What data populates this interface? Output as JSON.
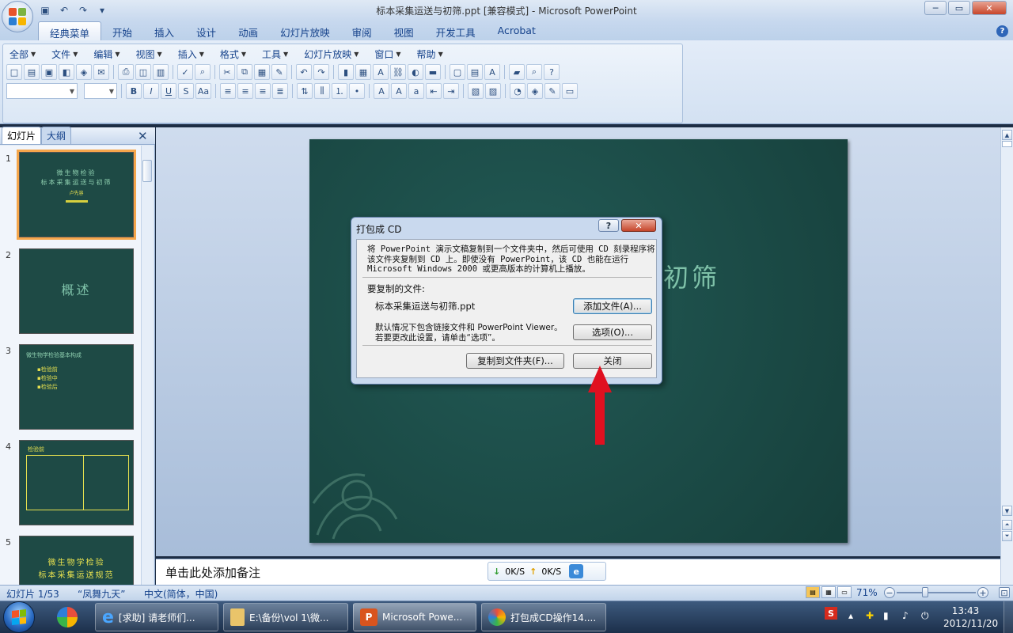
{
  "window": {
    "title": "标本采集运送与初筛.ppt [兼容模式] - Microsoft PowerPoint",
    "min": "─",
    "max": "▭",
    "close": "✕"
  },
  "ribbon": {
    "tabs": [
      "经典菜单",
      "开始",
      "插入",
      "设计",
      "动画",
      "幻灯片放映",
      "审阅",
      "视图",
      "开发工具",
      "Acrobat"
    ],
    "active_tab": "经典菜单",
    "menus": [
      "全部",
      "文件",
      "编辑",
      "视图",
      "插入",
      "格式",
      "工具",
      "幻灯片放映",
      "窗口",
      "帮助"
    ],
    "help": "?"
  },
  "pane": {
    "tab_slides": "幻灯片",
    "tab_outline": "大纲",
    "close": "✕"
  },
  "thumbnails": [
    {
      "num": "1",
      "lines": [
        "微生物检验",
        "标本采集运送与初筛",
        "卢先容"
      ]
    },
    {
      "num": "2",
      "lines": [
        "概述"
      ]
    },
    {
      "num": "3",
      "lines": [
        "微生物学检验基本构成",
        "▪检验前",
        "▪检验中",
        "▪检验后"
      ]
    },
    {
      "num": "4",
      "lines": [
        "检验前"
      ]
    },
    {
      "num": "5",
      "lines": [
        "微生物学检验",
        "标本采集运送规范"
      ]
    }
  ],
  "slide": {
    "visible_title_fragment": "初筛"
  },
  "dialog": {
    "title": "打包成 CD",
    "help_btn": "?",
    "close_btn": "✕",
    "description": "将 PowerPoint 演示文稿复制到一个文件夹中，然后可使用 CD 刻录程序将该文件夹复制到 CD 上。即使没有 PowerPoint，该 CD 也能在运行 Microsoft Windows 2000 或更高版本的计算机上播放。",
    "files_label": "要复制的文件:",
    "filename": "标本采集运送与初筛.ppt",
    "add_files_btn": "添加文件(A)...",
    "default_note": "默认情况下包含链接文件和 PowerPoint Viewer。若要更改此设置，请单击“选项”。",
    "options_btn": "选项(O)...",
    "copy_to_folder_btn": "复制到文件夹(F)...",
    "close_text_btn": "关闭"
  },
  "notes": {
    "placeholder": "单击此处添加备注"
  },
  "netspeed": {
    "down": "0K/S",
    "up": "0K/S"
  },
  "status": {
    "slide_pos": "幻灯片 1/53",
    "theme": "“凤舞九天”",
    "language": "中文(简体，中国)",
    "zoom": "71%"
  },
  "taskbar": {
    "tasks": [
      {
        "label": "[求助] 请老师们..."
      },
      {
        "label": "E:\\备份\\vol 1\\微..."
      },
      {
        "label": "Microsoft Powe..."
      },
      {
        "label": "打包成CD操作14...."
      }
    ],
    "time": "13:43",
    "date": "2012/11/20"
  },
  "colors": {
    "accent": "#15428b",
    "slide_bg": "#1e4a45",
    "arrow": "#e01020"
  }
}
